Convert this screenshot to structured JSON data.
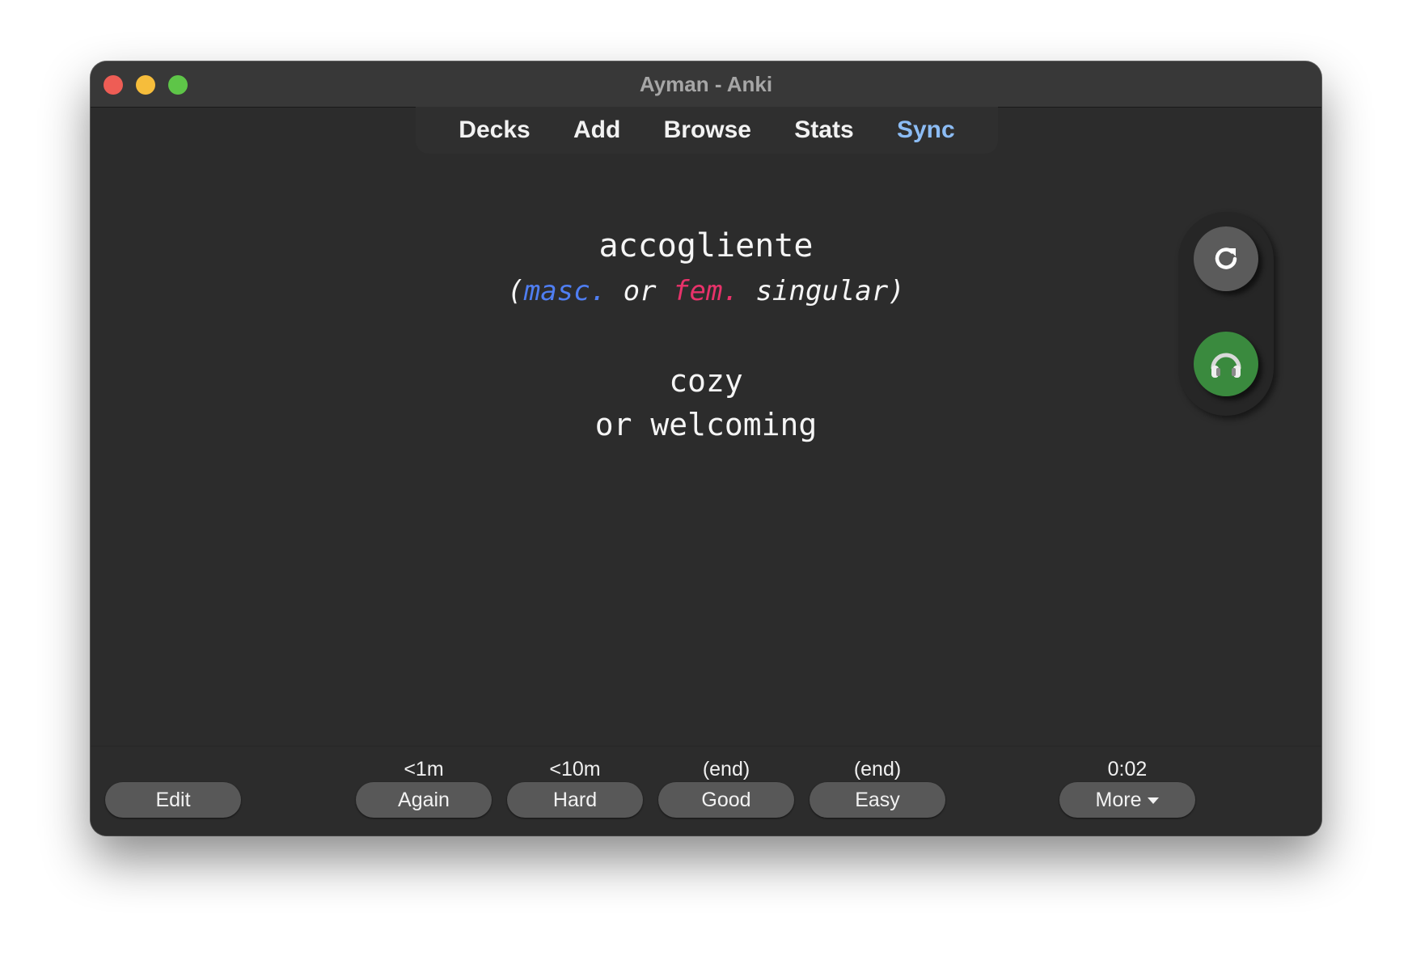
{
  "window": {
    "title": "Ayman - Anki"
  },
  "toolbar": {
    "items": [
      {
        "label": "Decks"
      },
      {
        "label": "Add"
      },
      {
        "label": "Browse"
      },
      {
        "label": "Stats"
      },
      {
        "label": "Sync"
      }
    ],
    "sync_color": "#8cbcf4"
  },
  "card": {
    "front_word": "accogliente",
    "note_open": "(",
    "note_masc": "masc.",
    "note_or": "or",
    "note_fem": "fem.",
    "note_rest": "singular)",
    "back_line1": "cozy",
    "back_line2": "or welcoming",
    "masc_color": "#4f7ef2",
    "fem_color": "#e8326a"
  },
  "side_panel": {
    "replay_icon": "replay-icon",
    "audio_icon": "headphones-icon",
    "audio_color": "#3a8a3e"
  },
  "bottom_bar": {
    "edit_label": "Edit",
    "answers": [
      {
        "interval": "<1m",
        "label": "Again"
      },
      {
        "interval": "<10m",
        "label": "Hard"
      },
      {
        "interval": "(end)",
        "label": "Good"
      },
      {
        "interval": "(end)",
        "label": "Easy"
      }
    ],
    "timer": "0:02",
    "more_label": "More"
  }
}
